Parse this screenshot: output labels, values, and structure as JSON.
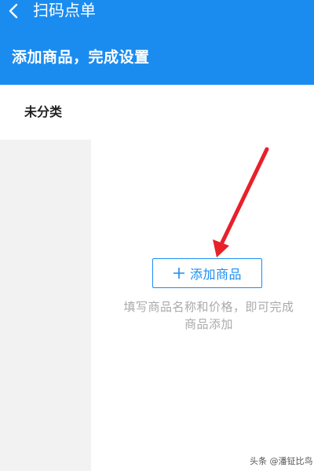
{
  "colors": {
    "accent": "#1a8cf0",
    "arrow": "#e8202a",
    "rail": "#f2f2f2"
  },
  "header": {
    "back_icon": "chevron-left-icon",
    "nav_title": "扫码点单",
    "heading": "添加商品，完成设置"
  },
  "category": {
    "tab_label": "未分类"
  },
  "empty_state": {
    "add_icon": "plus-icon",
    "add_button_label": "添加商品",
    "hint": "填写商品名称和价格，即可完成商品添加"
  },
  "annotation": {
    "icon": "red-arrow-icon"
  },
  "watermark": "头条 @潘钲比鸟"
}
